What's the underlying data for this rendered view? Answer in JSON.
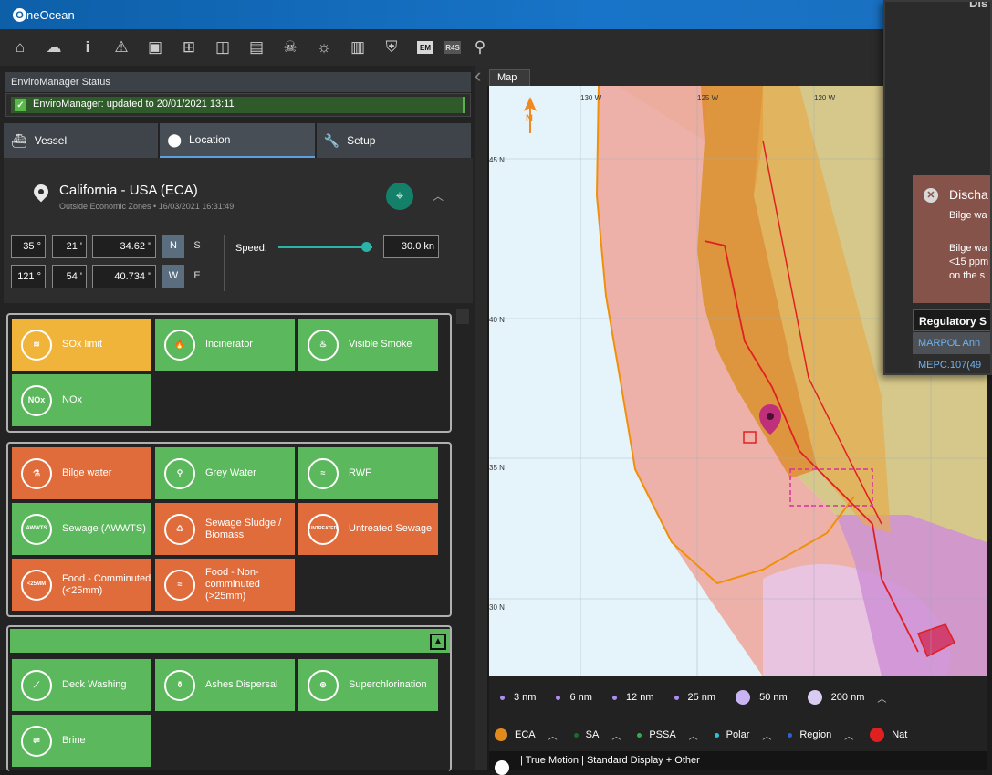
{
  "app": {
    "logo_letter": "O",
    "name": "neOcean"
  },
  "toolbar": {
    "icons": [
      "home-icon",
      "cloud-upload-icon",
      "info-icon",
      "warning-icon",
      "document-icon",
      "map-icon",
      "book-icon",
      "publication-icon",
      "skull-icon",
      "weather-icon",
      "report-icon",
      "shield-icon",
      "em-icon",
      "r4s-icon",
      "compass-icon"
    ],
    "em": "EM",
    "r4s": "R4S"
  },
  "status": {
    "header": "EnviroManager Status",
    "message": "EnviroManager: updated to 20/01/2021 13:11"
  },
  "tabs": [
    {
      "label": "Vessel",
      "icon": "ship-icon"
    },
    {
      "label": "Location",
      "icon": "pin-icon"
    },
    {
      "label": "Setup",
      "icon": "wrench-icon"
    }
  ],
  "location": {
    "title": "California - USA (ECA)",
    "subtitle": "Outside Economic Zones  •  16/03/2021 16:31:49",
    "lat": {
      "deg": "35 °",
      "min": "21 '",
      "sec": "34.62 \"",
      "hemi_a": "N",
      "hemi_b": "S"
    },
    "lon": {
      "deg": "121 °",
      "min": "54 '",
      "sec": "40.734 \"",
      "hemi_a": "W",
      "hemi_b": "E"
    },
    "speed_label": "Speed:",
    "speed_value": "30.0 kn",
    "speed_fraction": 0.93
  },
  "group1": [
    {
      "label": "SOx limit",
      "color": "yellow",
      "icon": "sox-icon"
    },
    {
      "label": "Incinerator",
      "color": "green",
      "icon": "flame-icon"
    },
    {
      "label": "Visible Smoke",
      "color": "green",
      "icon": "chimney-icon"
    },
    {
      "label": "NOx",
      "color": "green",
      "icon": "nox-icon",
      "badge": "NOx"
    }
  ],
  "group2": [
    {
      "label": "Bilge water",
      "color": "orange",
      "icon": "bilge-icon"
    },
    {
      "label": "Grey Water",
      "color": "green",
      "icon": "tap-icon"
    },
    {
      "label": "RWF",
      "color": "green",
      "icon": "waves-icon"
    },
    {
      "label": "Sewage (AWWTS)",
      "color": "green",
      "icon": "toilet-icon",
      "badge": "AWWTS"
    },
    {
      "label": "Sewage Sludge / Biomass",
      "color": "orange",
      "icon": "sludge-icon"
    },
    {
      "label": "Untreated Sewage",
      "color": "orange",
      "icon": "toilet-icon",
      "badge": "UNTREATED"
    },
    {
      "label": "Food - Comminuted (<25mm)",
      "color": "orange",
      "icon": "food-icon",
      "badge": "<25MM"
    },
    {
      "label": "Food - Non-comminuted (>25mm)",
      "color": "orange",
      "icon": "waves-icon"
    }
  ],
  "group3": [
    {
      "label": "Deck Washing",
      "color": "green",
      "icon": "mop-icon"
    },
    {
      "label": "Ashes Dispersal",
      "color": "green",
      "icon": "ash-icon"
    },
    {
      "label": "Superchlorination",
      "color": "green",
      "icon": "chlorine-icon"
    },
    {
      "label": "Brine",
      "color": "green",
      "icon": "brine-icon"
    }
  ],
  "map": {
    "tab": "Map",
    "lon_labels": [
      "130 W",
      "125 W",
      "120 W"
    ],
    "lat_labels": [
      "45 N",
      "40 N",
      "35 N",
      "30 N"
    ],
    "north": "N"
  },
  "legend_ranges": [
    {
      "label": "3 nm"
    },
    {
      "label": "6 nm"
    },
    {
      "label": "12 nm"
    },
    {
      "label": "25 nm"
    },
    {
      "label": "50 nm"
    },
    {
      "label": "200 nm"
    }
  ],
  "legend_zones": [
    {
      "label": "ECA",
      "color": "#e08a1e"
    },
    {
      "label": "SA",
      "color": "#1e6a2a"
    },
    {
      "label": "PSSA",
      "color": "#2fae4a"
    },
    {
      "label": "Polar",
      "color": "#29c6d8"
    },
    {
      "label": "Region",
      "color": "#2d5fd8"
    },
    {
      "label": "Nat",
      "color": "#e02020"
    }
  ],
  "footer": "| True Motion | Standard Display + Other",
  "panel": {
    "title": "Dis",
    "alert_title": "Discha",
    "alert_line1": "Bilge wa",
    "alert_line2": "Bilge wa",
    "alert_line3": "<15 ppm",
    "alert_line4": "on the s",
    "reg_header": "Regulatory S",
    "reg_row1": "MARPOL Ann",
    "reg_row2": "MEPC.107(49"
  }
}
